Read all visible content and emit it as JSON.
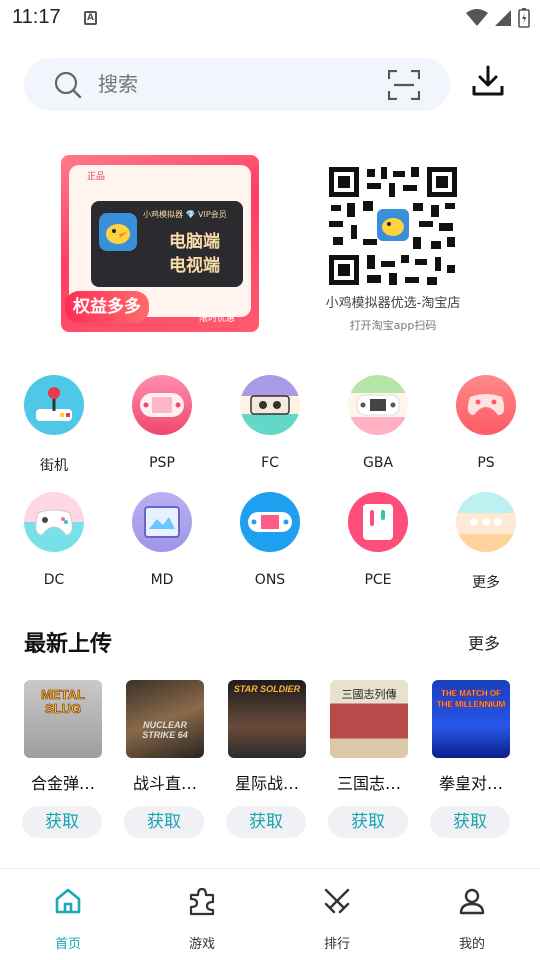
{
  "status": {
    "time": "11:17",
    "a_icon": "A"
  },
  "search": {
    "placeholder": "搜索"
  },
  "banner": {
    "tag": "正品",
    "vip_text": "小鸡模拟器 💎 VIP会员",
    "line1": "电脑端",
    "line2": "电视端",
    "badge": "权益多多",
    "limit": "限时优惠"
  },
  "qr": {
    "title": "小鸡模拟器优选-淘宝店",
    "subtitle": "打开淘宝app扫码"
  },
  "categories": [
    {
      "label": "街机",
      "icon": "arcade-icon"
    },
    {
      "label": "PSP",
      "icon": "psp-icon"
    },
    {
      "label": "FC",
      "icon": "fc-icon"
    },
    {
      "label": "GBA",
      "icon": "gba-icon"
    },
    {
      "label": "PS",
      "icon": "ps-icon"
    },
    {
      "label": "DC",
      "icon": "dc-icon"
    },
    {
      "label": "MD",
      "icon": "md-icon"
    },
    {
      "label": "ONS",
      "icon": "ons-icon"
    },
    {
      "label": "PCE",
      "icon": "pce-icon"
    },
    {
      "label": "更多",
      "icon": "more-icon"
    }
  ],
  "latest": {
    "title": "最新上传",
    "more": "更多",
    "games": [
      {
        "name": "合金弹…",
        "button": "获取",
        "cover_text": "METAL SLUG"
      },
      {
        "name": "战斗直…",
        "button": "获取",
        "cover_text": "NUCLEAR STRIKE 64"
      },
      {
        "name": "星际战…",
        "button": "获取",
        "cover_text": "STAR SOLDIER"
      },
      {
        "name": "三国志…",
        "button": "获取",
        "cover_text": "三國志列傳"
      },
      {
        "name": "拳皇对…",
        "button": "获取",
        "cover_text": "THE MATCH OF THE MILLENNIUM"
      }
    ]
  },
  "nav": [
    {
      "label": "首页",
      "icon": "home-icon",
      "active": true
    },
    {
      "label": "游戏",
      "icon": "puzzle-icon",
      "active": false
    },
    {
      "label": "排行",
      "icon": "swords-icon",
      "active": false
    },
    {
      "label": "我的",
      "icon": "user-icon",
      "active": false
    }
  ],
  "colors": {
    "accent": "#1aa8b4",
    "search_bg": "#f2f5fb",
    "button_bg": "#f0f1f4"
  }
}
